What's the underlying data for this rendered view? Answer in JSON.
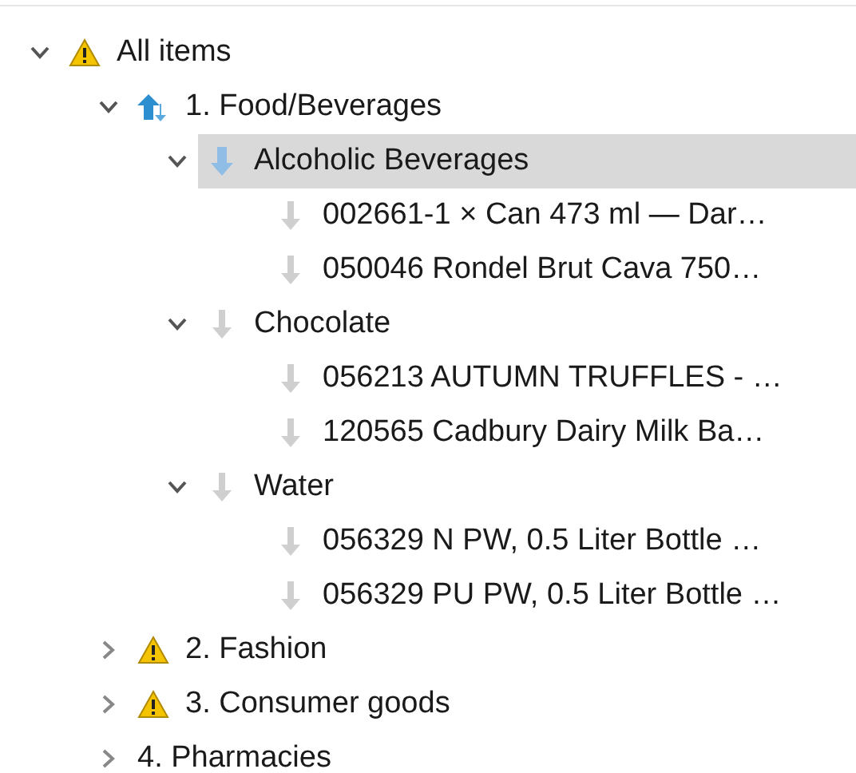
{
  "tree": [
    {
      "label": "All items",
      "kind": "warning",
      "expanded": true,
      "selected": false,
      "children": [
        {
          "label": "1. Food/Beverages",
          "kind": "category",
          "expanded": true,
          "selected": false,
          "children": [
            {
              "label": "Alcoholic Beverages",
              "kind": "group",
              "expanded": true,
              "selected": true,
              "children": [
                {
                  "label": "002661-1 × Can 473 ml — Dar…",
                  "kind": "item",
                  "selected": false
                },
                {
                  "label": "050046 Rondel Brut Cava 750…",
                  "kind": "item",
                  "selected": false
                }
              ]
            },
            {
              "label": "Chocolate",
              "kind": "item",
              "expanded": true,
              "selected": false,
              "children": [
                {
                  "label": "056213 AUTUMN TRUFFLES - …",
                  "kind": "item",
                  "selected": false
                },
                {
                  "label": "120565 Cadbury Dairy Milk Ba…",
                  "kind": "item",
                  "selected": false
                }
              ]
            },
            {
              "label": "Water",
              "kind": "item",
              "expanded": true,
              "selected": false,
              "children": [
                {
                  "label": "056329 N PW, 0.5 Liter Bottle …",
                  "kind": "item",
                  "selected": false
                },
                {
                  "label": "056329 PU PW, 0.5 Liter Bottle …",
                  "kind": "item",
                  "selected": false
                }
              ]
            }
          ]
        },
        {
          "label": "2. Fashion",
          "kind": "warning",
          "expanded": false,
          "selected": false
        },
        {
          "label": "3. Consumer goods",
          "kind": "warning",
          "expanded": false,
          "selected": false
        },
        {
          "label": "4. Pharmacies",
          "kind": "plain",
          "expanded": false,
          "selected": false
        }
      ]
    }
  ]
}
